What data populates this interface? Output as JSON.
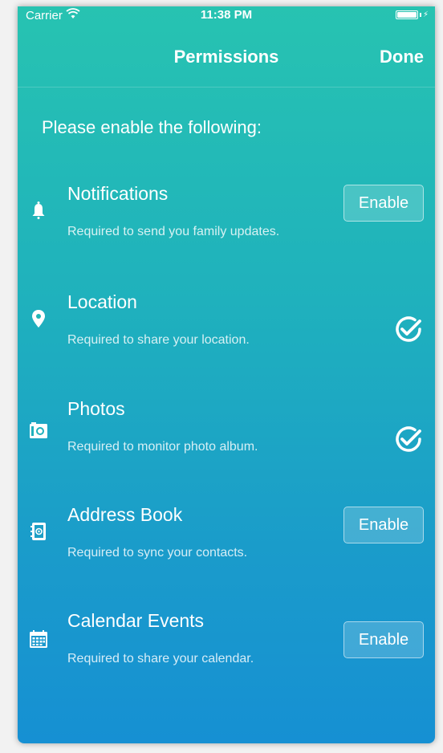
{
  "status_bar": {
    "carrier": "Carrier",
    "time": "11:38 PM",
    "battery_level": 1.0
  },
  "nav": {
    "title": "Permissions",
    "done_label": "Done"
  },
  "intro": "Please enable the following:",
  "permissions": [
    {
      "title": "Notifications",
      "description": "Required to send you family updates.",
      "state": "enable",
      "action_label": "Enable",
      "icon": "bell-icon"
    },
    {
      "title": "Location",
      "description": "Required to share your location.",
      "state": "granted",
      "icon": "location-pin-icon"
    },
    {
      "title": "Photos",
      "description": "Required to monitor photo album.",
      "state": "granted",
      "icon": "camera-icon"
    },
    {
      "title": "Address Book",
      "description": "Required to sync your contacts.",
      "state": "enable",
      "action_label": "Enable",
      "icon": "address-book-icon"
    },
    {
      "title": "Calendar Events",
      "description": "Required to share your calendar.",
      "state": "enable",
      "action_label": "Enable",
      "icon": "calendar-icon"
    }
  ],
  "colors": {
    "gradient_top": "#27c3b1",
    "gradient_bottom": "#1690d3",
    "text": "#ffffff"
  }
}
